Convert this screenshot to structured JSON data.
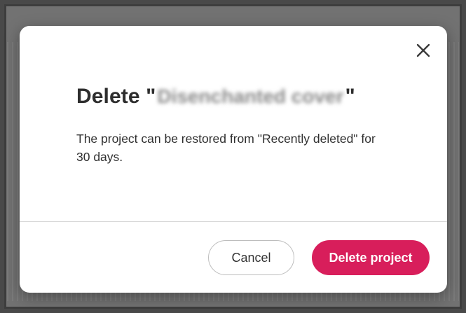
{
  "dialog": {
    "title_prefix": "Delete \"",
    "project_name": "Disenchanted cover",
    "title_suffix": "\"",
    "message": "The project can be restored from \"Recently deleted\" for 30 days.",
    "close_icon": "close-icon",
    "cancel_label": "Cancel",
    "confirm_label": "Delete project"
  },
  "colors": {
    "confirm_button_bg": "#d81e5b",
    "confirm_button_text": "#ffffff",
    "title_text": "#2e2e2e"
  }
}
